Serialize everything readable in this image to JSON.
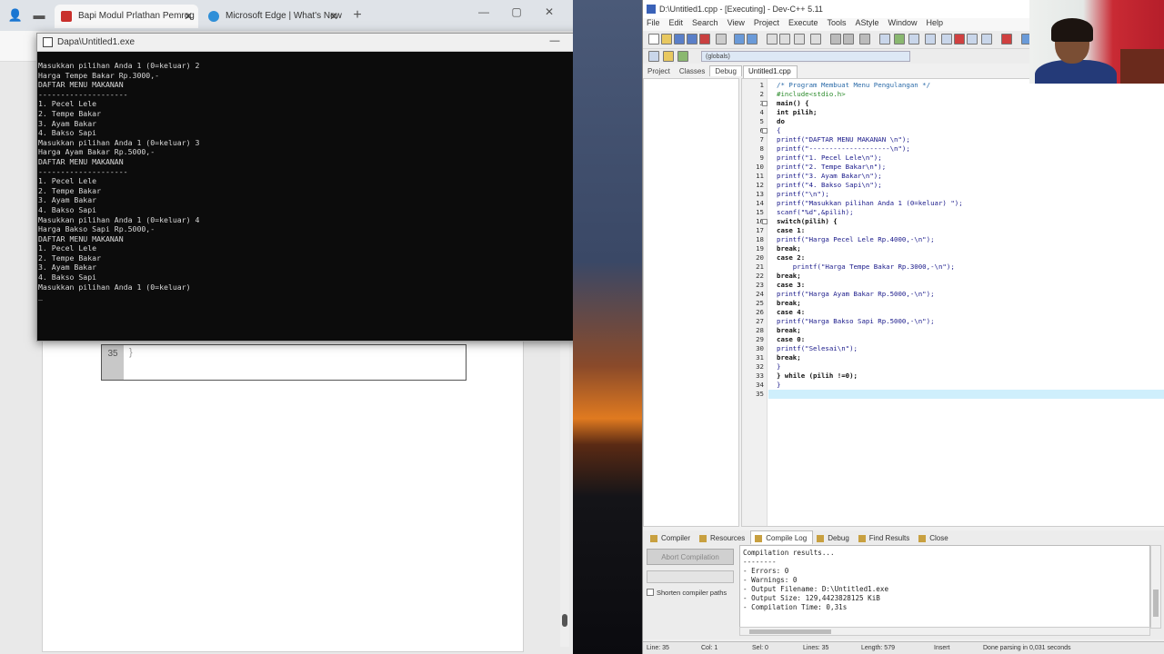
{
  "browser": {
    "tabs": [
      {
        "label": "Bapi Modul Prlathan Pemrog",
        "active": true
      },
      {
        "label": "Microsoft Edge | What's New",
        "active": false
      }
    ],
    "new_tab": "+",
    "win_controls": [
      "—",
      "▢",
      "✕"
    ]
  },
  "doc": {
    "code_line_number": "35",
    "code_text": "}"
  },
  "console": {
    "title": "Dapa\\Untitled1.exe",
    "controls": [
      "—",
      "▢",
      "✕"
    ],
    "lines": [
      "Masukkan pilihan Anda 1 (0=keluar) 2",
      "Harga Tempe Bakar Rp.3000,-",
      "DAFTAR MENU MAKANAN",
      "--------------------",
      "1. Pecel Lele",
      "2. Tempe Bakar",
      "3. Ayam Bakar",
      "4. Bakso Sapi",
      "",
      "Masukkan pilihan Anda 1 (0=keluar) 3",
      "Harga Ayam Bakar Rp.5000,-",
      "DAFTAR MENU MAKANAN",
      "--------------------",
      "1. Pecel Lele",
      "2. Tempe Bakar",
      "3. Ayam Bakar",
      "4. Bakso Sapi",
      "",
      "Masukkan pilihan Anda 1 (0=keluar) 4",
      "Harga Bakso Sapi Rp.5000,-",
      "DAFTAR MENU MAKANAN",
      "",
      "1. Pecel Lele",
      "2. Tempe Bakar",
      "3. Ayam Bakar",
      "4. Bakso Sapi",
      "",
      "Masukkan pilihan Anda 1 (0=keluar)",
      "_"
    ]
  },
  "ide": {
    "title": "D:\\Untitled1.cpp - [Executing] - Dev-C++ 5.11",
    "menu": [
      "File",
      "Edit",
      "Search",
      "View",
      "Project",
      "Execute",
      "Tools",
      "AStyle",
      "Window",
      "Help"
    ],
    "combo": "(globals)",
    "left_tabs": [
      "Project",
      "Classes",
      "Debug"
    ],
    "file_tab": "Untitled1.cpp",
    "lines": [
      {
        "n": "1",
        "text": "/* Program Membuat Menu Pengulangan */",
        "cls": "cmt"
      },
      {
        "n": "2",
        "text": "#include<stdio.h>",
        "cls": "pp"
      },
      {
        "n": "3",
        "text": "main() {",
        "cls": "kw"
      },
      {
        "n": "4",
        "text": "int pilih;",
        "cls": "kw"
      },
      {
        "n": "5",
        "text": "do",
        "cls": "kw"
      },
      {
        "n": "6",
        "text": "{",
        "cls": ""
      },
      {
        "n": "7",
        "text": "printf(\"DAFTAR MENU MAKANAN \\n\");",
        "cls": ""
      },
      {
        "n": "8",
        "text": "printf(\"--------------------\\n\");",
        "cls": ""
      },
      {
        "n": "9",
        "text": "printf(\"1. Pecel Lele\\n\");",
        "cls": ""
      },
      {
        "n": "10",
        "text": "printf(\"2. Tempe Bakar\\n\");",
        "cls": ""
      },
      {
        "n": "11",
        "text": "printf(\"3. Ayam Bakar\\n\");",
        "cls": ""
      },
      {
        "n": "12",
        "text": "printf(\"4. Bakso Sapi\\n\");",
        "cls": ""
      },
      {
        "n": "13",
        "text": "printf(\"\\n\");",
        "cls": ""
      },
      {
        "n": "14",
        "text": "printf(\"Masukkan pilihan Anda 1 (0=keluar) \");",
        "cls": ""
      },
      {
        "n": "15",
        "text": "scanf(\"%d\",&pilih);",
        "cls": ""
      },
      {
        "n": "16",
        "text": "switch(pilih) {",
        "cls": "kw"
      },
      {
        "n": "17",
        "text": "case 1:",
        "cls": "kw"
      },
      {
        "n": "18",
        "text": "printf(\"Harga Pecel Lele Rp.4000,-\\n\");",
        "cls": ""
      },
      {
        "n": "19",
        "text": "break;",
        "cls": "kw"
      },
      {
        "n": "20",
        "text": "case 2:",
        "cls": "kw"
      },
      {
        "n": "21",
        "text": "    printf(\"Harga Tempe Bakar Rp.3000,-\\n\");",
        "cls": ""
      },
      {
        "n": "22",
        "text": "break;",
        "cls": "kw"
      },
      {
        "n": "23",
        "text": "case 3:",
        "cls": "kw"
      },
      {
        "n": "24",
        "text": "printf(\"Harga Ayam Bakar Rp.5000,-\\n\");",
        "cls": ""
      },
      {
        "n": "25",
        "text": "break;",
        "cls": "kw"
      },
      {
        "n": "26",
        "text": "case 4:",
        "cls": "kw"
      },
      {
        "n": "27",
        "text": "printf(\"Harga Bakso Sapi Rp.5000,-\\n\");",
        "cls": ""
      },
      {
        "n": "28",
        "text": "break;",
        "cls": "kw"
      },
      {
        "n": "29",
        "text": "case 0:",
        "cls": "kw"
      },
      {
        "n": "30",
        "text": "printf(\"Selesai\\n\");",
        "cls": ""
      },
      {
        "n": "31",
        "text": "break;",
        "cls": "kw"
      },
      {
        "n": "32",
        "text": "}",
        "cls": ""
      },
      {
        "n": "33",
        "text": "} while (pilih !=0);",
        "cls": "kw"
      },
      {
        "n": "34",
        "text": "}",
        "cls": ""
      },
      {
        "n": "35",
        "text": "",
        "cls": ""
      }
    ],
    "bottom_tabs": [
      "Compiler",
      "Resources",
      "Compile Log",
      "Debug",
      "Find Results",
      "Close"
    ],
    "abort_label": "Abort Compilation",
    "shorten_label": "Shorten compiler paths",
    "log": [
      "Compilation results...",
      "--------",
      "- Errors: 0",
      "- Warnings: 0",
      "- Output Filename: D:\\Untitled1.exe",
      "- Output Size: 129,4423828125 KiB",
      "- Compilation Time: 0,31s"
    ],
    "status": {
      "line": "Line: 35",
      "col": "Col: 1",
      "sel": "Sel: 0",
      "lines": "Lines: 35",
      "length": "Length: 579",
      "mode": "Insert",
      "done": "Done parsing in 0,031 seconds"
    }
  }
}
